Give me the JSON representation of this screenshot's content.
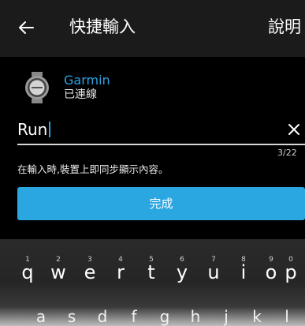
{
  "appbar": {
    "title": "快捷輸入",
    "help_label": "說明"
  },
  "device": {
    "name": "Garmin",
    "status": "已連線"
  },
  "input": {
    "value": "Run",
    "char_count": "3/22"
  },
  "hint": "在輸入時,裝置上即同步顯示內容。",
  "done_button": "完成",
  "keyboard": {
    "row1": [
      {
        "hint": "1",
        "letter": "q"
      },
      {
        "hint": "2",
        "letter": "w"
      },
      {
        "hint": "3",
        "letter": "e"
      },
      {
        "hint": "4",
        "letter": "r"
      },
      {
        "hint": "5",
        "letter": "t"
      },
      {
        "hint": "6",
        "letter": "y"
      },
      {
        "hint": "7",
        "letter": "u"
      },
      {
        "hint": "8",
        "letter": "i"
      },
      {
        "hint": "9",
        "letter": "o"
      },
      {
        "hint": "0",
        "letter": "p"
      }
    ],
    "row2": [
      "a",
      "s",
      "d",
      "f",
      "g",
      "h",
      "j",
      "k",
      "l"
    ]
  },
  "colors": {
    "accent": "#2aa6e0",
    "appbar_bg": "#1b1b1b",
    "background": "#000000"
  },
  "icons": [
    "back-arrow-icon",
    "watch-icon",
    "clear-icon"
  ]
}
